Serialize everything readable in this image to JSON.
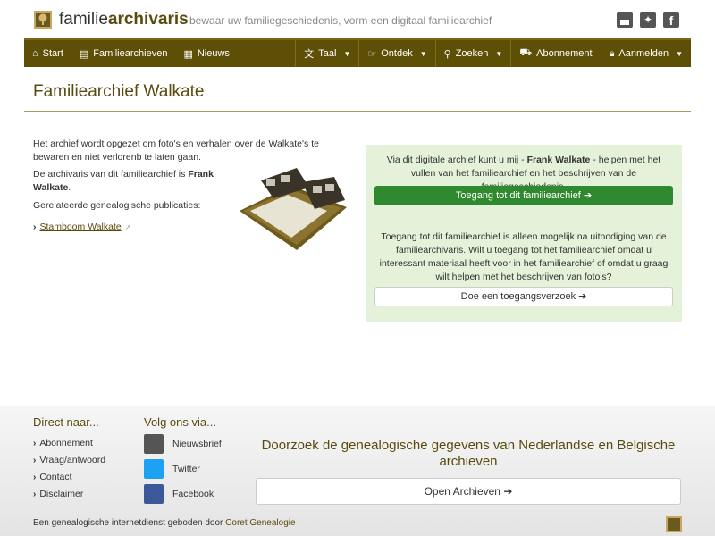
{
  "header": {
    "brand_part1": "familie",
    "brand_part2": "archivaris",
    "tagline": "bewaar uw familiegeschiedenis, vorm een digitaal familiearchief"
  },
  "nav": {
    "left": [
      {
        "label": "Start",
        "icon": "home-icon"
      },
      {
        "label": "Familiearchieven",
        "icon": "book-icon"
      },
      {
        "label": "Nieuws",
        "icon": "newspaper-icon"
      }
    ],
    "right": [
      {
        "label": "Taal",
        "icon": "language-icon"
      },
      {
        "label": "Ontdek",
        "icon": "hand-icon"
      },
      {
        "label": "Zoeken",
        "icon": "search-icon"
      },
      {
        "label": "Abonnement",
        "icon": "cart-icon"
      },
      {
        "label": "Aanmelden",
        "icon": "lock-icon"
      }
    ]
  },
  "page": {
    "title": "Familiearchief Walkate",
    "intro": "Het archief wordt opgezet om foto's en verhalen over de Walkate's te bewaren en niet verlorenb te laten gaan.",
    "archivist_prefix": "De archivaris van dit familiearchief is ",
    "archivist_name": "Frank Walkate",
    "archivist_suffix": ".",
    "publications_label": "Gerelateerde genealogische publicaties:",
    "stamboom_link": "Stamboom Walkate"
  },
  "panel": {
    "text1_prefix": "Via dit digitale archief kunt u mij - ",
    "text1_name": "Frank Walkate",
    "text1_suffix": " - helpen met het vullen van het familiearchief en het beschrijven van de familiegeschiedenis.",
    "access_button": "Toegang tot dit familiearchief",
    "text2": "Toegang tot dit familiearchief is alleen mogelijk na uitnodiging van de familiearchivaris. Wilt u toegang tot het familiearchief omdat u interessant materiaal heeft voor in het familiearchief of omdat u graag wilt helpen met het beschrijven van foto's?",
    "request_button": "Doe een toegangsverzoek"
  },
  "footer": {
    "direct_heading": "Direct naar...",
    "direct_links": [
      "Abonnement",
      "Vraag/antwoord",
      "Contact",
      "Disclaimer"
    ],
    "follow_heading": "Volg ons via...",
    "follow_links": [
      "Nieuwsbrief",
      "Twitter",
      "Facebook"
    ],
    "search_title": "Doorzoek de genealogische gegevens van Nederlandse en Belgische archieven",
    "open_archieven": "Open Archieven",
    "credit_prefix": "Een genealogische internetdienst geboden door ",
    "credit_link": "Coret Genealogie"
  }
}
